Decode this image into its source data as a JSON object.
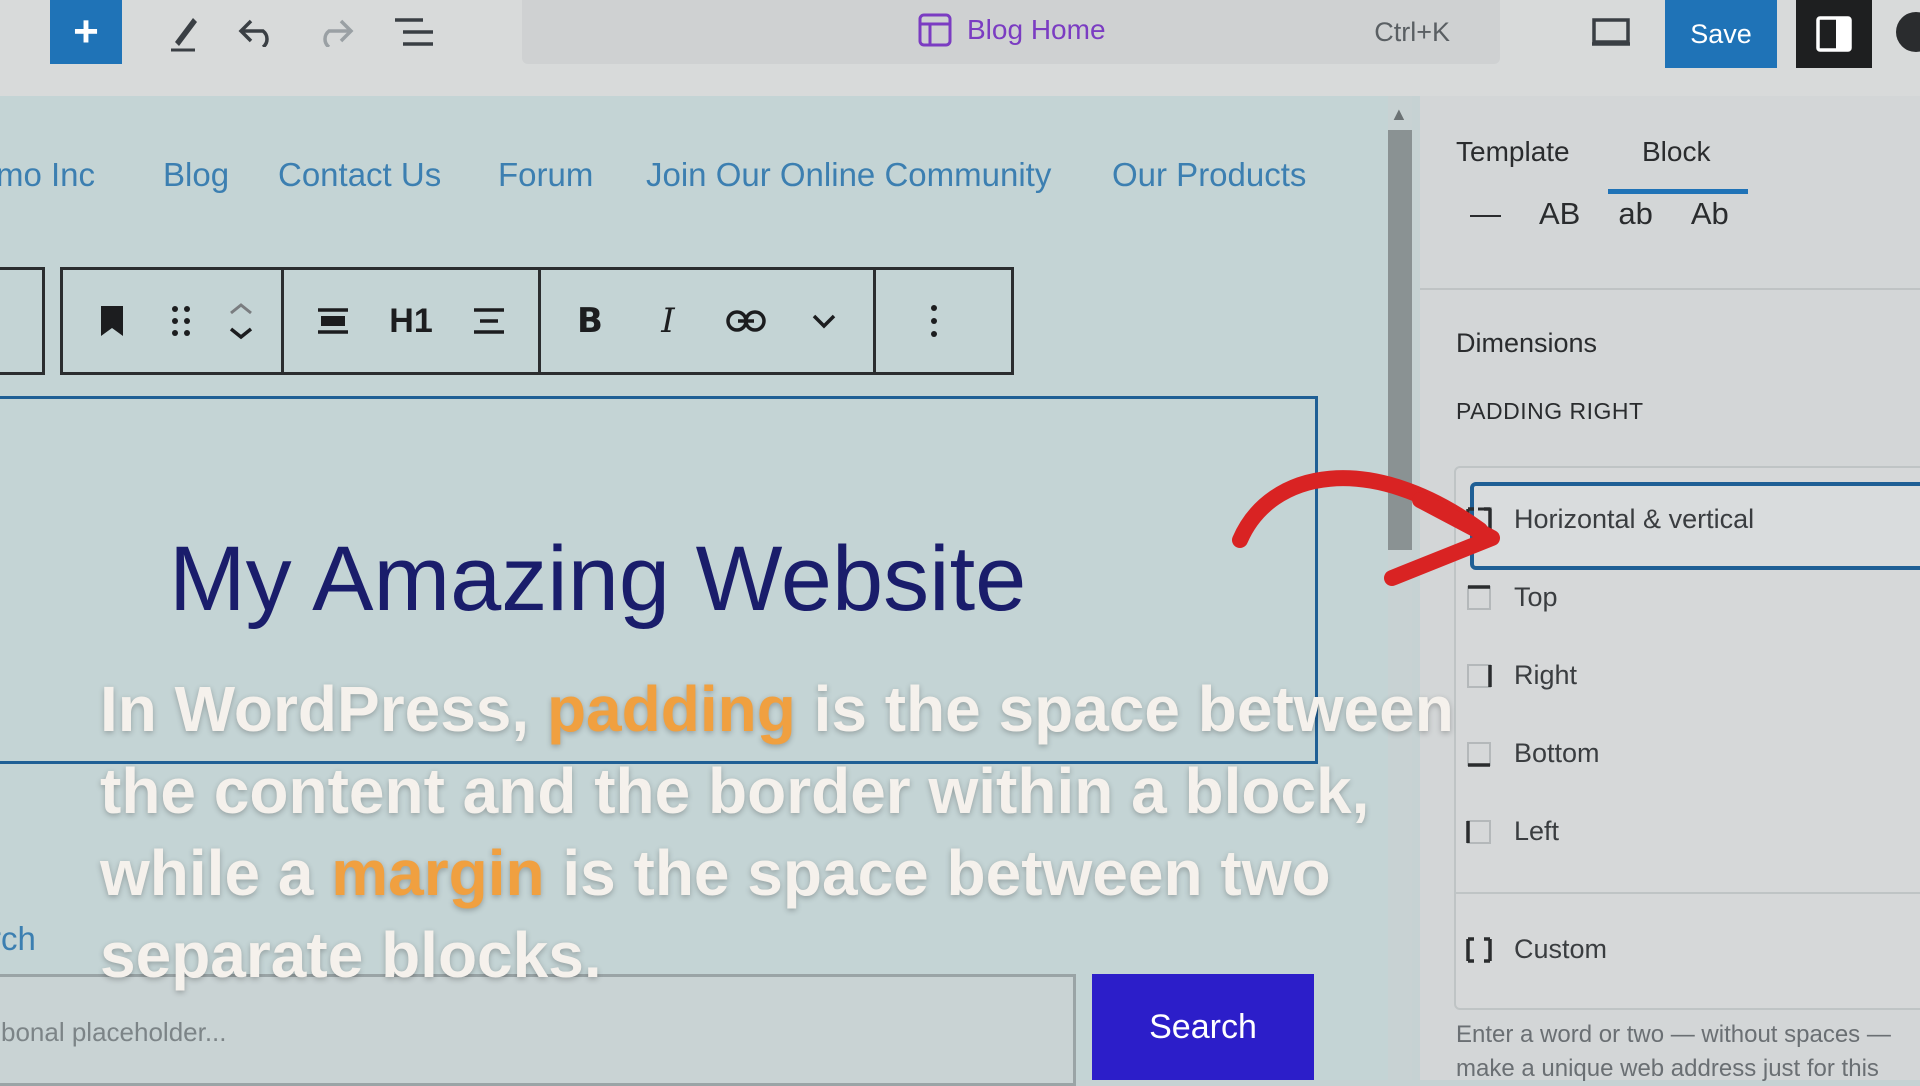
{
  "toolbar": {
    "document_title": "Blog Home",
    "shortcut": "Ctrl+K",
    "save_label": "Save",
    "accent": "#1f73b7"
  },
  "nav": {
    "items": [
      "mo Inc",
      "Blog",
      "Contact Us",
      "Forum",
      "Join Our Online Community",
      "Our Products"
    ]
  },
  "block_toolbar": {
    "heading_level_label": "H1"
  },
  "heading": {
    "text": "My Amazing Website"
  },
  "search": {
    "label": "rch",
    "placeholder": "bonal placeholder...",
    "button_label": "Search"
  },
  "sidebar": {
    "tabs": [
      "Template",
      "Block"
    ],
    "active_tab": "Block",
    "case_options": [
      "—",
      "AB",
      "ab",
      "Ab"
    ],
    "section_title": "Dimensions",
    "padding_label": "PADDING RIGHT",
    "dropdown_options": [
      "Horizontal & vertical",
      "Top",
      "Right",
      "Bottom",
      "Left",
      "Custom"
    ],
    "selected_option": "Horizontal & vertical",
    "help_text_line1": "Enter a word or two — without spaces —",
    "help_text_line2": "make a unique web address just for this"
  },
  "caption": {
    "part1": "In WordPress, ",
    "highlight1": "padding",
    "part2": " is the space between the content and the border within a block, while a ",
    "highlight2": "margin",
    "part3": " is the space between two separate blocks.",
    "highlight_color": "#f0a040"
  }
}
